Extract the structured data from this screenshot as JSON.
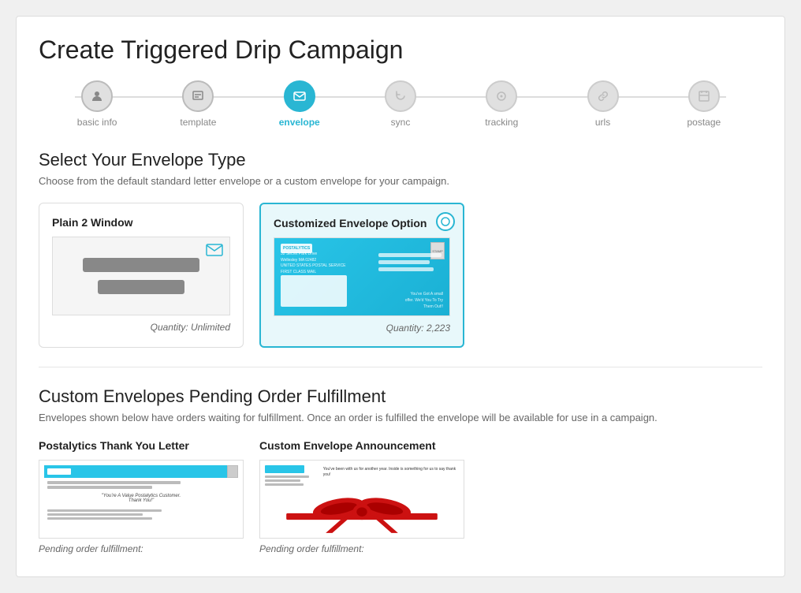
{
  "page": {
    "title": "Create Triggered Drip Campaign"
  },
  "stepper": {
    "steps": [
      {
        "id": "basic-info",
        "label": "basic info",
        "icon": "👤",
        "state": "completed"
      },
      {
        "id": "template",
        "label": "template",
        "icon": "🖼",
        "state": "completed"
      },
      {
        "id": "envelope",
        "label": "envelope",
        "icon": "✉",
        "state": "active"
      },
      {
        "id": "sync",
        "label": "sync",
        "icon": "⚙",
        "state": "default"
      },
      {
        "id": "tracking",
        "label": "tracking",
        "icon": "⚙",
        "state": "default"
      },
      {
        "id": "urls",
        "label": "urls",
        "icon": "🔗",
        "state": "default"
      },
      {
        "id": "postage",
        "label": "postage",
        "icon": "📅",
        "state": "default"
      }
    ]
  },
  "envelope_section": {
    "title": "Select Your Envelope Type",
    "description": "Choose from the default standard letter envelope or a custom envelope for your campaign.",
    "cards": [
      {
        "id": "plain-2-window",
        "title": "Plain 2 Window",
        "quantity_label": "Quantity: Unlimited",
        "selected": false
      },
      {
        "id": "customized-envelope",
        "title": "Customized Envelope Option",
        "quantity_label": "Quantity: 2,223",
        "selected": true
      }
    ]
  },
  "pending_section": {
    "title": "Custom Envelopes Pending Order Fulfillment",
    "description": "Envelopes shown below have orders waiting for fulfillment. Once an order is fulfilled the envelope will be available for use in a campaign.",
    "cards": [
      {
        "id": "postalytics-thank-you",
        "title": "Postalytics Thank You Letter",
        "pending_label": "Pending order fulfillment:"
      },
      {
        "id": "custom-announcement",
        "title": "Custom Envelope Announcement",
        "pending_label": "Pending order fulfillment:"
      }
    ]
  }
}
